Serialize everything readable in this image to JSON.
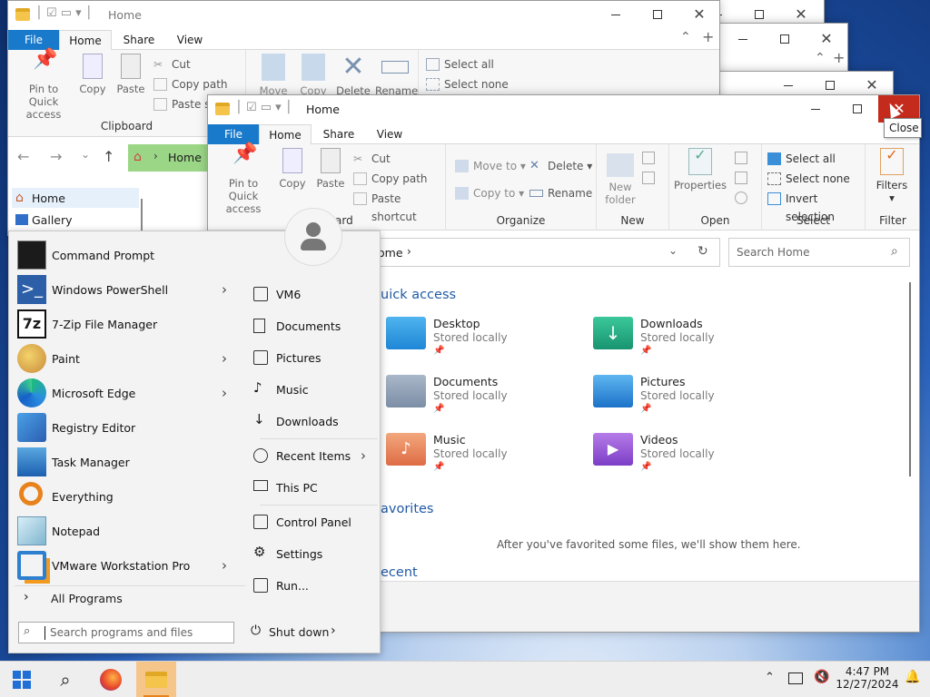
{
  "explorer": {
    "title": "Home",
    "tabs": {
      "file": "File",
      "home": "Home",
      "share": "Share",
      "view": "View"
    },
    "clipboard": {
      "pin": "Pin to Quick\naccess",
      "copy": "Copy",
      "paste": "Paste",
      "cut": "Cut",
      "copy_path": "Copy path",
      "paste_shortcut": "Paste shortcut",
      "group": "Clipboard",
      "paste_sh_truncated": "Paste sh",
      "group_partial": "ard"
    },
    "organize": {
      "move_to": "Move to",
      "copy_to": "Copy to",
      "delete": "Delete",
      "rename": "Rename",
      "group": "Organize",
      "move_short": "Move",
      "copy_short": "Copy"
    },
    "new": {
      "new_folder": "New\nfolder",
      "group": "New"
    },
    "open": {
      "properties": "Properties",
      "group": "Open"
    },
    "select": {
      "select_all": "Select all",
      "select_none": "Select none",
      "invert": "Invert selection",
      "group": "Select"
    },
    "filter": {
      "filters": "Filters",
      "group": "Filter"
    },
    "tooltip": "Close",
    "address": "Home",
    "address_partial": "ome",
    "search_placeholder": "Search Home",
    "quick_access_heading": "Quick access",
    "quick_access_partial": "uick access",
    "favorites_partial": "avorites",
    "recent_partial": "ecent",
    "favorites_empty": "After you've favorited some files, we'll show them here.",
    "folders": [
      {
        "name": "Desktop",
        "status": "Stored locally"
      },
      {
        "name": "Downloads",
        "status": "Stored locally"
      },
      {
        "name": "Documents",
        "status": "Stored locally"
      },
      {
        "name": "Pictures",
        "status": "Stored locally"
      },
      {
        "name": "Music",
        "status": "Stored locally"
      },
      {
        "name": "Videos",
        "status": "Stored locally"
      }
    ],
    "nav": [
      {
        "label": "Home"
      },
      {
        "label": "Gallery"
      }
    ]
  },
  "start_menu": {
    "apps": [
      {
        "label": "Command Prompt",
        "icon": "cmd-icon",
        "arrow": false
      },
      {
        "label": "Windows PowerShell",
        "icon": "powershell-icon",
        "arrow": true
      },
      {
        "label": "7-Zip File Manager",
        "icon": "7zip-icon",
        "arrow": false
      },
      {
        "label": "Paint",
        "icon": "paint-icon",
        "arrow": true
      },
      {
        "label": "Microsoft Edge",
        "icon": "edge-icon",
        "arrow": true
      },
      {
        "label": "Registry Editor",
        "icon": "registry-icon",
        "arrow": false
      },
      {
        "label": "Task Manager",
        "icon": "task-manager-icon",
        "arrow": false
      },
      {
        "label": "Everything",
        "icon": "everything-icon",
        "arrow": false
      },
      {
        "label": "Notepad",
        "icon": "notepad-icon",
        "arrow": false
      },
      {
        "label": "VMware Workstation Pro",
        "icon": "vmware-icon",
        "arrow": true
      }
    ],
    "all_programs": "All Programs",
    "places": [
      {
        "label": "VM6",
        "icon": "user-folder-icon"
      },
      {
        "label": "Documents",
        "icon": "document-icon"
      },
      {
        "label": "Pictures",
        "icon": "picture-icon"
      },
      {
        "label": "Music",
        "icon": "music-icon"
      },
      {
        "label": "Downloads",
        "icon": "download-icon"
      },
      {
        "label": "Recent Items",
        "icon": "recent-icon"
      },
      {
        "label": "This PC",
        "icon": "pc-icon"
      },
      {
        "label": "Control Panel",
        "icon": "control-panel-icon"
      },
      {
        "label": "Settings",
        "icon": "settings-icon"
      },
      {
        "label": "Run...",
        "icon": "run-icon"
      }
    ],
    "search_placeholder": "Search programs and files",
    "shutdown": "Shut down"
  },
  "taskbar": {
    "time": "4:47 PM",
    "date": "12/27/2024"
  },
  "colors": {
    "accent": "#1979ca",
    "close_hover": "#c42b1c"
  }
}
